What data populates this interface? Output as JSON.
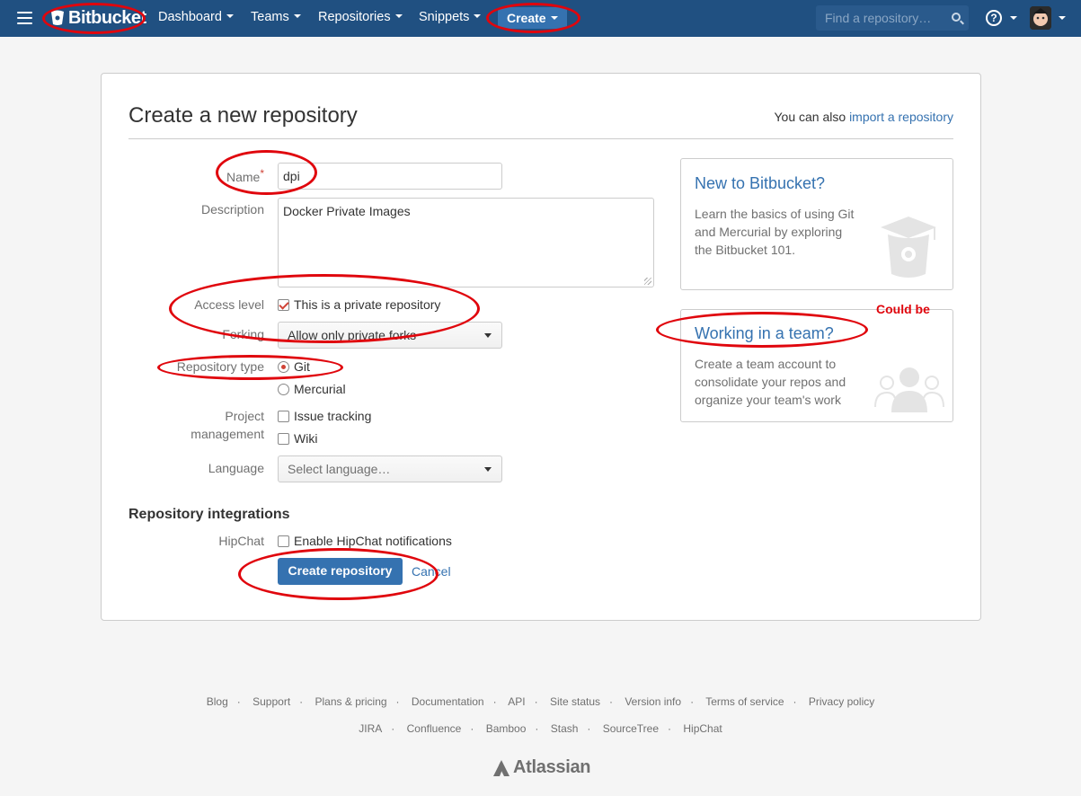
{
  "nav": {
    "logo_text": "Bitbucket",
    "items": [
      {
        "label": "Dashboard"
      },
      {
        "label": "Teams"
      },
      {
        "label": "Repositories"
      },
      {
        "label": "Snippets"
      }
    ],
    "create_label": "Create",
    "search_placeholder": "Find a repository…",
    "help_glyph": "?"
  },
  "form": {
    "title": "Create a new repository",
    "import_prefix": "You can also",
    "import_link": "import a repository",
    "name_label": "Name",
    "name_required_mark": "*",
    "name_value": "dpi",
    "description_label": "Description",
    "description_value": "Docker Private Images",
    "access_label": "Access level",
    "access_checkbox_label": "This is a private repository",
    "access_checked": true,
    "forking_label": "Forking",
    "forking_value": "Allow only private forks",
    "repo_type_label": "Repository type",
    "repo_type_options": [
      {
        "label": "Git",
        "selected": true
      },
      {
        "label": "Mercurial",
        "selected": false
      }
    ],
    "project_mgmt_label_line1": "Project",
    "project_mgmt_label_line2": "management",
    "project_mgmt_options": [
      {
        "label": "Issue tracking",
        "checked": false
      },
      {
        "label": "Wiki",
        "checked": false
      }
    ],
    "language_label": "Language",
    "language_placeholder": "Select language…",
    "integrations_heading": "Repository integrations",
    "hipchat_label": "HipChat",
    "hipchat_option": "Enable HipChat notifications",
    "submit_label": "Create repository",
    "cancel_label": "Cancel"
  },
  "cards": {
    "new_title": "New to Bitbucket?",
    "new_body": "Learn the basics of using Git and Mercurial by exploring the Bitbucket 101.",
    "team_title": "Working in a team?",
    "team_body": "Create a team account to consolidate your repos and organize your team's work"
  },
  "annotation_note": "Could be",
  "footer": {
    "row1": [
      "Blog",
      "Support",
      "Plans & pricing",
      "Documentation",
      "API",
      "Site status",
      "Version info",
      "Terms of service",
      "Privacy policy"
    ],
    "row2": [
      "JIRA",
      "Confluence",
      "Bamboo",
      "Stash",
      "SourceTree",
      "HipChat"
    ],
    "atlassian_logo_text": "Atlassian"
  },
  "colors": {
    "header_bg": "#205081",
    "primary": "#3572b0",
    "annotation_red": "#e0060d",
    "required_red": "#d04437"
  }
}
